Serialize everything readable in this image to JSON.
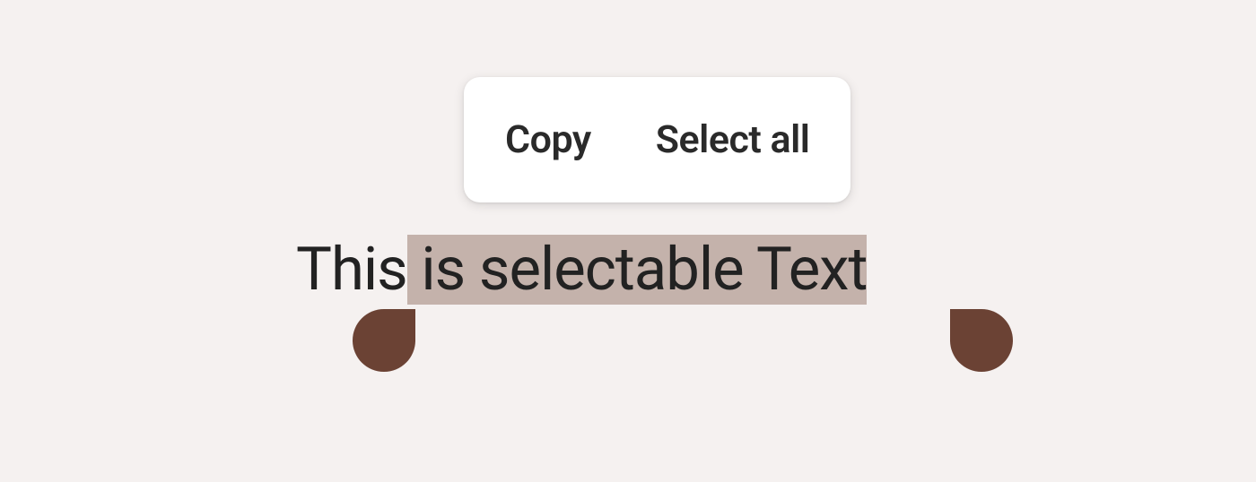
{
  "context_menu": {
    "copy_label": "Copy",
    "select_all_label": "Select all"
  },
  "text": {
    "before_selection": "This",
    "selection": " is selectable Text",
    "after_selection": ""
  },
  "colors": {
    "background": "#f5f1f0",
    "selection_highlight": "#c4b2ab",
    "handle": "#6b4234",
    "menu_bg": "#ffffff",
    "text": "#222222"
  }
}
